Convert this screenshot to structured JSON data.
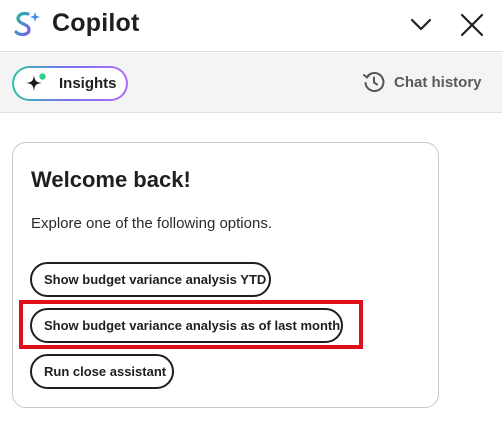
{
  "app": {
    "title": "Copilot"
  },
  "header": {
    "collapse_icon": "chevron-down-icon",
    "close_icon": "close-icon"
  },
  "toolbar": {
    "insights_label": "Insights",
    "insights_icon": "sparkle-icon",
    "history_label": "Chat history",
    "history_icon": "history-clock-icon"
  },
  "card": {
    "title": "Welcome back!",
    "subtitle": "Explore one of the following options.",
    "options": [
      {
        "label": "Show budget variance analysis YTD"
      },
      {
        "label": "Show budget variance analysis as of last month"
      },
      {
        "label": "Run close assistant"
      }
    ]
  },
  "colors": {
    "highlight": "#e0101a",
    "accent_green": "#2fc2a8",
    "accent_purple": "#7b6ff0"
  }
}
